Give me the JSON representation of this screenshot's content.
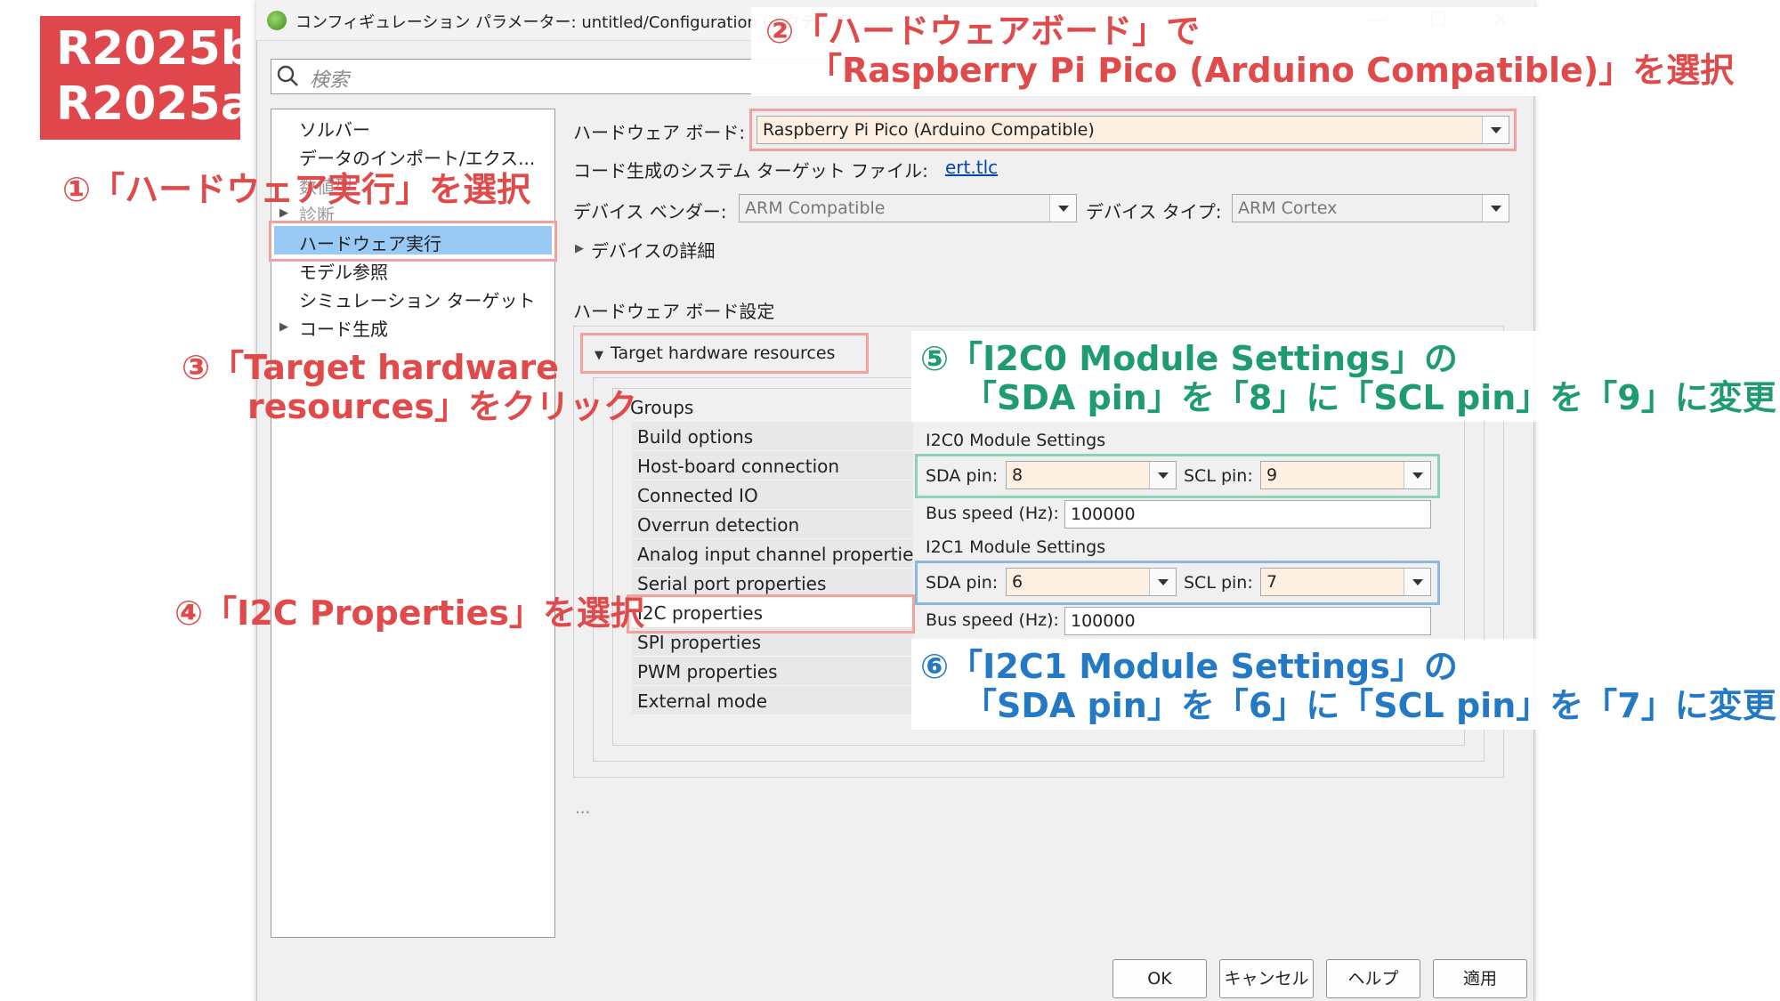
{
  "version_badge": {
    "line1": "R2025b",
    "line2": "R2025a",
    "color": "#e0474c"
  },
  "window": {
    "title": "コンフィギュレーション パラメーター: untitled/Configuration (アクティブ)",
    "controls": [
      "—",
      "☐",
      "✕"
    ]
  },
  "search": {
    "placeholder": "検索"
  },
  "tree": {
    "items": [
      {
        "label": "ソルバー",
        "arrow": ""
      },
      {
        "label": "データのインポート/エクス...",
        "arrow": ""
      },
      {
        "label": "数値型",
        "arrow": ""
      },
      {
        "label": "診断",
        "arrow": "▶"
      },
      {
        "label": "ハードウェア実行",
        "arrow": "",
        "selected": true
      },
      {
        "label": "モデル参照",
        "arrow": ""
      },
      {
        "label": "シミュレーション ターゲット",
        "arrow": ""
      },
      {
        "label": "コード生成",
        "arrow": "▶"
      }
    ]
  },
  "hardware": {
    "board_label": "ハードウェア ボード:",
    "board_value": "Raspberry Pi Pico (Arduino Compatible)",
    "tlc_label": "コード生成のシステム ターゲット ファイル:",
    "tlc_link": "ert.tlc",
    "vendor_label": "デバイス ベンダー:",
    "vendor_value": "ARM Compatible",
    "type_label": "デバイス タイプ:",
    "type_value": "ARM Cortex",
    "details_label": "デバイスの詳細",
    "details_arrow": "▶",
    "board_settings_label": "ハードウェア ボード設定",
    "resources_label": "Target hardware resources",
    "resources_arrow": "▼"
  },
  "groups": {
    "title": "Groups",
    "items": [
      "Build options",
      "Host-board connection",
      "Connected IO",
      "Overrun detection",
      "Analog input channel properties",
      "Serial port properties",
      "I2C properties",
      "SPI properties",
      "PWM properties",
      "External mode"
    ],
    "selected": "I2C properties"
  },
  "i2c0": {
    "title": "I2C0 Module Settings",
    "sda_label": "SDA pin:",
    "sda_value": "8",
    "scl_label": "SCL pin:",
    "scl_value": "9",
    "speed_label": "Bus speed (Hz):",
    "speed_value": "100000"
  },
  "i2c1": {
    "title": "I2C1 Module Settings",
    "sda_label": "SDA pin:",
    "sda_value": "6",
    "scl_label": "SCL pin:",
    "scl_value": "7",
    "speed_label": "Bus speed (Hz):",
    "speed_value": "100000"
  },
  "ellipsis": "...",
  "buttons": {
    "ok": "OK",
    "cancel": "キャンセル",
    "help": "ヘルプ",
    "apply": "適用"
  },
  "annotations": {
    "step1": "①「ハードウェア実行」を選択",
    "step2_line1": "②「ハードウェアボード」で",
    "step2_line2": "「Raspberry Pi Pico (Arduino Compatible)」を選択",
    "step3_line1": "③「Target hardware",
    "step3_line2": "resources」をクリック",
    "step4": "④「I2C Properties」を選択",
    "step5_line1": "⑤「I2C0 Module Settings」の",
    "step5_line2": "「SDA pin」を「8」に「SCL pin」を「9」に変更",
    "step6_line1": "⑥「I2C1 Module Settings」の",
    "step6_line2": "「SDA pin」を「6」に「SCL pin」を「7」に変更"
  },
  "colors": {
    "red": "#e04a4a",
    "green": "#1e9b73",
    "blue": "#2479c5",
    "selection": "#99c9f5"
  }
}
